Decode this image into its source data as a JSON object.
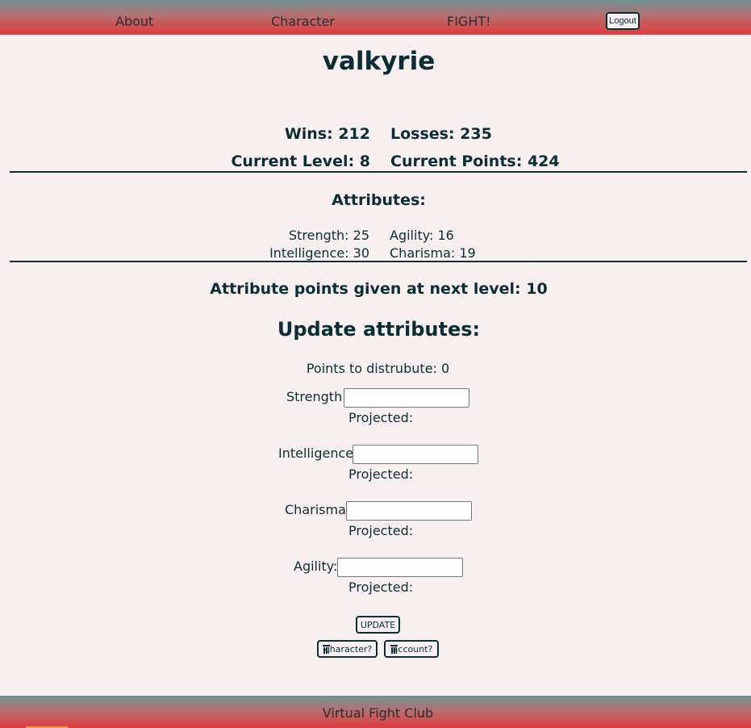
{
  "nav": {
    "items": [
      {
        "label": "About"
      },
      {
        "label": "Character"
      },
      {
        "label": "FIGHT!"
      }
    ],
    "logout_label": "Logout"
  },
  "character": {
    "name": "valkyrie",
    "wins": "Wins: 212",
    "losses": "Losses: 235",
    "current_level": "Current Level: 8",
    "current_points": "Current Points: 424"
  },
  "attributes": {
    "heading": "Attributes:",
    "strength": "Strength: 25",
    "agility": "Agility: 16",
    "intelligence": "Intelligence: 30",
    "charisma": "Charisma: 19"
  },
  "next_level_points": "Attribute points given at next level: 10",
  "update_form": {
    "heading": "Update attributes:",
    "points_to_distribute": "Points to distrubute: 0",
    "fields": [
      {
        "label": "Strength:",
        "value": "",
        "projected": "Projected:"
      },
      {
        "label": "Intelligence:",
        "value": "",
        "projected": "Projected:"
      },
      {
        "label": "Charisma:",
        "value": "",
        "projected": "Projected:"
      },
      {
        "label": "Agility:",
        "value": "",
        "projected": "Projected:"
      }
    ],
    "update_label": "UPDATE",
    "delete_character_label": "character?",
    "delete_account_label": "account?"
  },
  "footer": {
    "text": "Virtual Fight Club"
  }
}
